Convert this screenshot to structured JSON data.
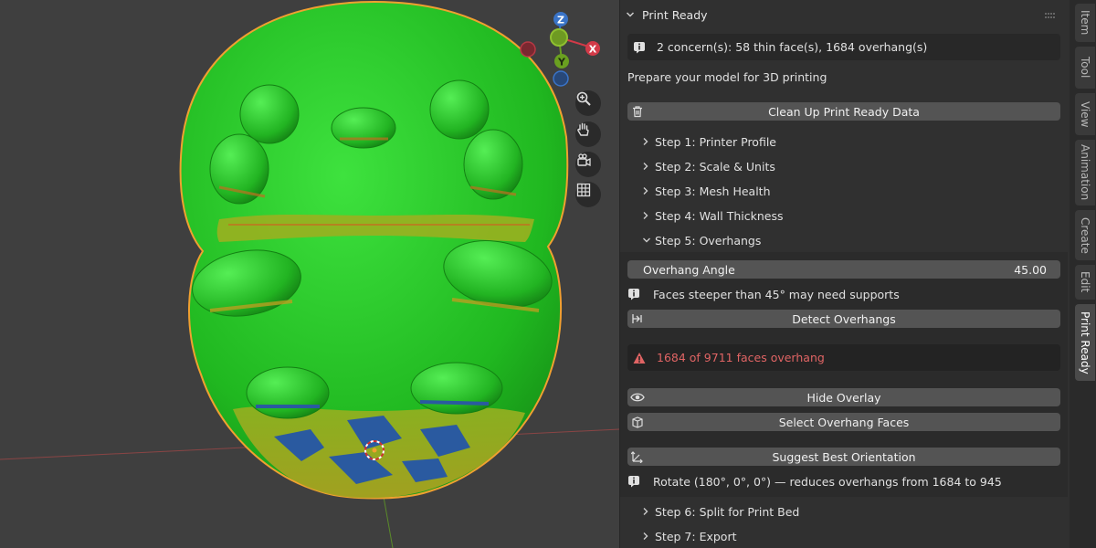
{
  "gizmo": {
    "z": "Z",
    "x": "X",
    "y": "Y"
  },
  "viewport_tools": [
    "zoom-icon",
    "hand-icon",
    "camera-icon",
    "grid-icon"
  ],
  "panel": {
    "title": "Print Ready",
    "concerns": "2 concern(s): 58 thin face(s), 1684 overhang(s)",
    "subtitle": "Prepare your model for 3D printing",
    "cleanup_button": "Clean Up Print Ready Data",
    "steps_top": [
      "Step 1: Printer Profile",
      "Step 2: Scale & Units",
      "Step 3: Mesh Health",
      "Step 4: Wall Thickness",
      "Step 5: Overhangs"
    ],
    "overhang": {
      "angle_label": "Overhang Angle",
      "angle_value": "45.00",
      "info": "Faces steeper than 45° may need supports",
      "detect_button": "Detect Overhangs",
      "warning": "1684 of 9711 faces overhang",
      "hide_overlay_button": "Hide Overlay",
      "select_faces_button": "Select Overhang Faces",
      "suggest_button": "Suggest Best Orientation",
      "suggestion": "Rotate (180°, 0°, 0°) — reduces overhangs from 1684 to 945"
    },
    "steps_bottom": [
      "Step 6: Split for Print Bed",
      "Step 7: Export"
    ]
  },
  "tabs": [
    "Item",
    "Tool",
    "View",
    "Animation",
    "Create",
    "Edit",
    "Print Ready"
  ],
  "colors": {
    "accent": "#4772b3",
    "warning": "#e06464",
    "model": "#22b822",
    "outline": "#f0a030"
  }
}
